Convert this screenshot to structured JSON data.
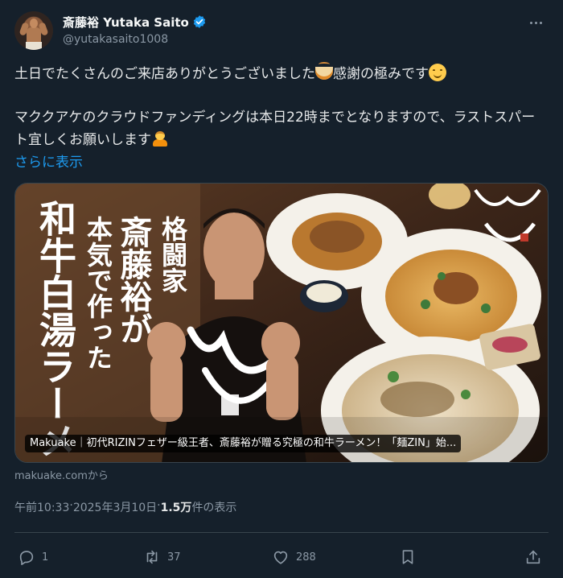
{
  "author": {
    "display_name": "斎藤裕 Yutaka Saito",
    "handle": "@yutakasaito1008",
    "verified": true,
    "verified_color": "#1d9bf0"
  },
  "tweet": {
    "line1": "土日でたくさんのご来店ありがとうございました",
    "line1_after_emoji": "感謝の極みです",
    "line2": "マククアケのクラウドファンディングは本日22時までとなりますので、ラストスパート宜しくお願いします",
    "show_more": "さらに表示",
    "emojis": [
      "ramen-emoji",
      "smiling-face-emoji",
      "bowing-person-emoji"
    ]
  },
  "card": {
    "image_poster_text": [
      "格闘家",
      "斎藤裕が",
      "本気で作った",
      "和牛白湯ラーメン"
    ],
    "caption": "Makuake｜初代RIZINフェザー級王者、斎藤裕が贈る究極の和牛ラーメン！「麺ZIN」始...",
    "source": "makuake.comから"
  },
  "meta": {
    "time": "午前10:33",
    "separator": " · ",
    "date": "2025年3月10日",
    "views_count": "1.5万",
    "views_label": " 件の表示"
  },
  "actions": {
    "reply_count": "1",
    "retweet_count": "37",
    "like_count": "288"
  },
  "colors": {
    "background": "#15202b",
    "link": "#1d9bf0",
    "secondary_text": "#8b98a5",
    "border": "#38444d"
  }
}
